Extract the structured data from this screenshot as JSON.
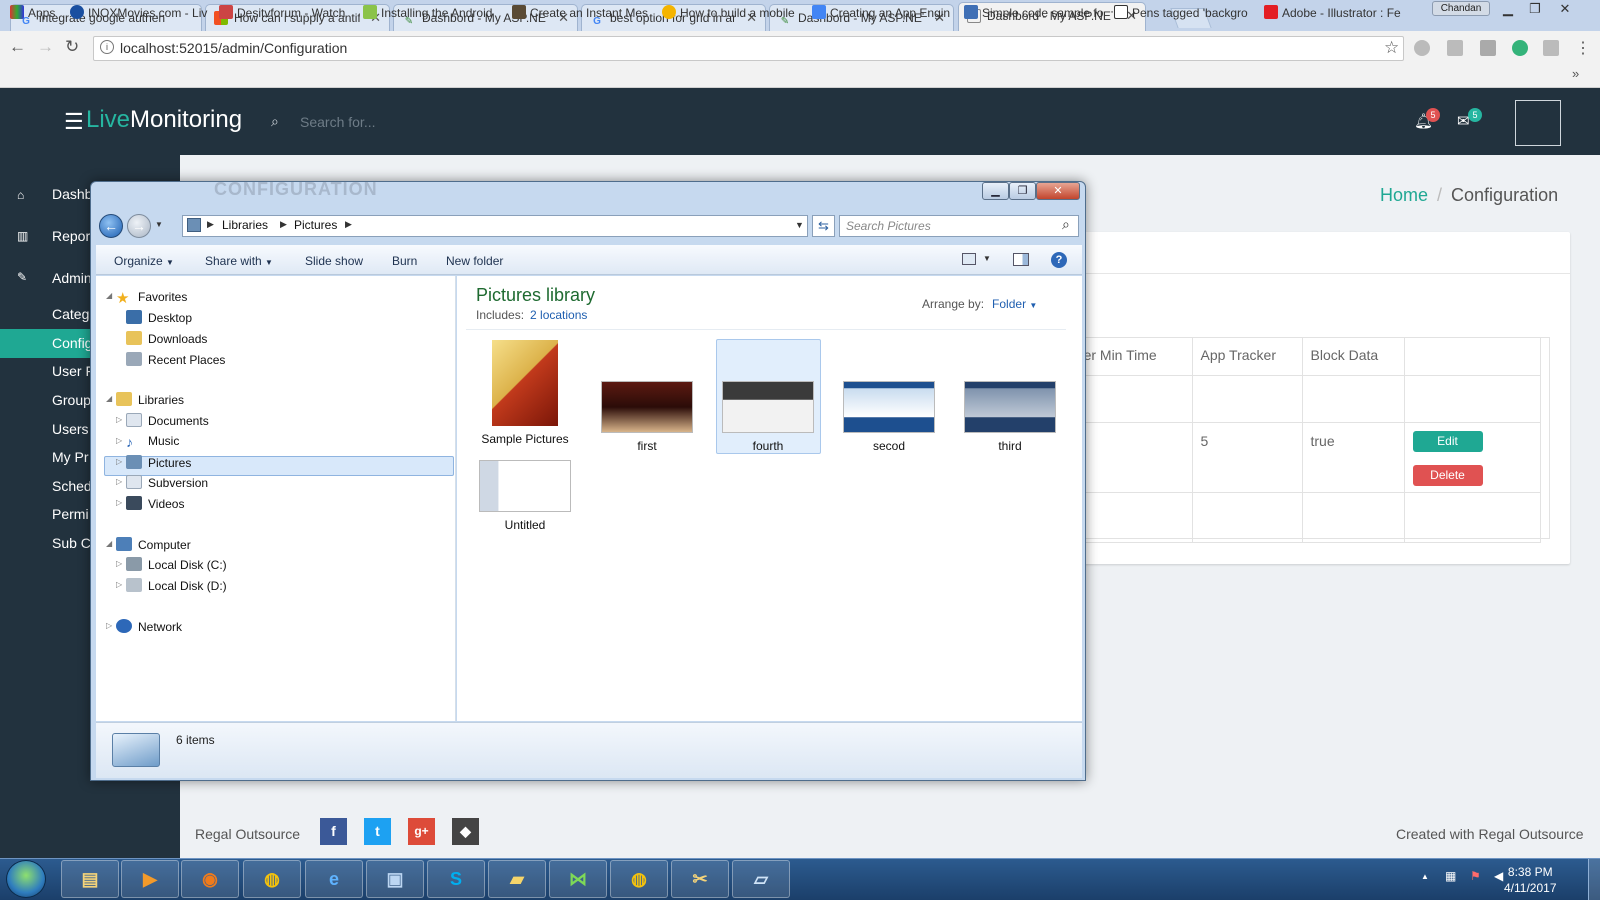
{
  "browser": {
    "tabs": [
      {
        "title": "integrate google authen",
        "icon": "google"
      },
      {
        "title": "How can i supply a antifo",
        "icon": "microsoft"
      },
      {
        "title": "Dashbord - My ASP.NET",
        "icon": "aspnet"
      },
      {
        "title": "best option for grid in an",
        "icon": "google"
      },
      {
        "title": "Dashbord - My ASP.NET",
        "icon": "aspnet"
      },
      {
        "title": "Dashbord - My ASP.NET",
        "icon": "page"
      }
    ],
    "profile": "Chandan",
    "url": "localhost:52015/admin/Configuration",
    "bookmarks": [
      "Apps",
      "INOXMovies.com - Liv",
      "Desitvforum - Watch",
      "Installing the Android",
      "Create an Instant Mes",
      "How to build a mobile",
      "Creating an App Engin",
      "Simple code sample fo",
      "Pens tagged 'backgro",
      "Adobe - Illustrator : Fe"
    ]
  },
  "app": {
    "logo_live": "Live",
    "logo_rest": "Monitoring",
    "search_placeholder": "Search for...",
    "notif_count": "5",
    "mail_count": "5",
    "sidebar": [
      "Dashb",
      "Repor",
      "Admin",
      "Categ",
      "Config",
      "User F",
      "Group",
      "Users",
      "My Pr",
      "Sched",
      "Permi",
      "Sub C"
    ],
    "page_heading": "CONFIGURATION",
    "breadcrumb": {
      "home": "Home",
      "sep": "/",
      "current": "Configuration"
    },
    "table": {
      "headers": [
        "gger Min Time",
        "App Tracker",
        "Block Data",
        ""
      ],
      "row": {
        "app_tracker": "5",
        "block_data": "true"
      },
      "edit": "Edit",
      "delete": "Delete"
    },
    "footer_left": "Regal Outsource",
    "footer_right": "Created with Regal Outsource"
  },
  "explorer": {
    "breadcrumb": [
      "Libraries",
      "Pictures"
    ],
    "search_placeholder": "Search Pictures",
    "commands": [
      "Organize",
      "Share with",
      "Slide show",
      "Burn",
      "New folder"
    ],
    "nav": {
      "favorites": "Favorites",
      "fav_items": [
        "Desktop",
        "Downloads",
        "Recent Places"
      ],
      "libraries": "Libraries",
      "lib_items": [
        "Documents",
        "Music",
        "Pictures",
        "Subversion",
        "Videos"
      ],
      "computer": "Computer",
      "comp_items": [
        "Local Disk (C:)",
        "Local Disk (D:)"
      ],
      "network": "Network"
    },
    "library_title": "Pictures library",
    "includes_label": "Includes:",
    "includes_link": "2 locations",
    "arrange_label": "Arrange by:",
    "arrange_value": "Folder",
    "items": [
      "Sample Pictures",
      "first",
      "fourth",
      "secod",
      "third",
      "Untitled"
    ],
    "status": "6 items"
  },
  "taskbar": {
    "time": "8:38 PM",
    "date": "4/11/2017"
  }
}
